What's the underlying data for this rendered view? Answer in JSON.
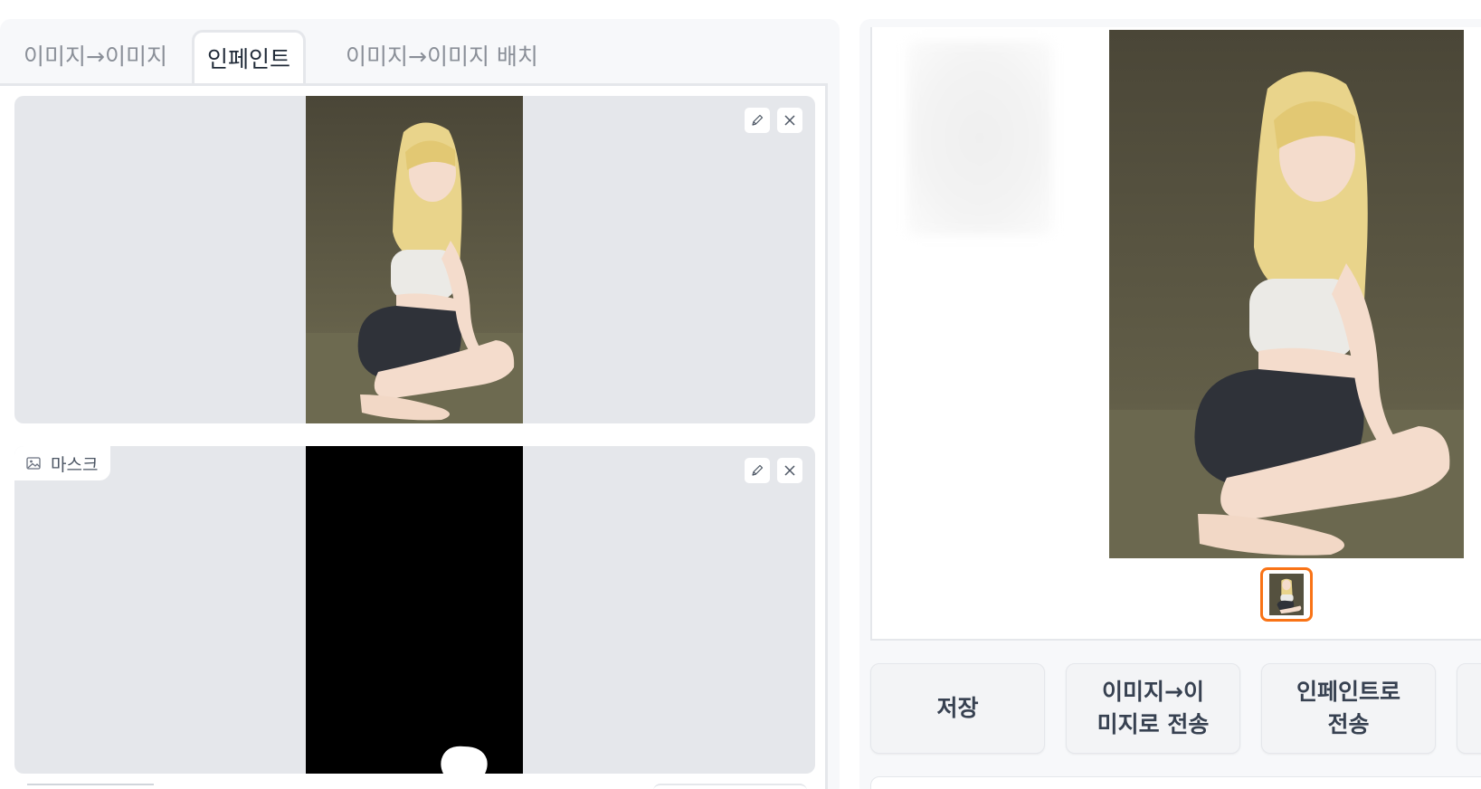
{
  "tabs": [
    {
      "label": "이미지→이미지",
      "active": false
    },
    {
      "label": "인페인트",
      "active": true
    },
    {
      "label": "이미지→이미지 배치",
      "active": false
    }
  ],
  "inpaint": {
    "mask_label": "마스크",
    "edit_icon": "pencil-icon",
    "close_icon": "close-icon"
  },
  "gallery": {
    "selected_index": 0,
    "accent": "#f97316"
  },
  "actions": [
    {
      "label": "저장"
    },
    {
      "label": "이미지→이\n미지로 전송"
    },
    {
      "label": "인페인트로\n전송"
    }
  ]
}
